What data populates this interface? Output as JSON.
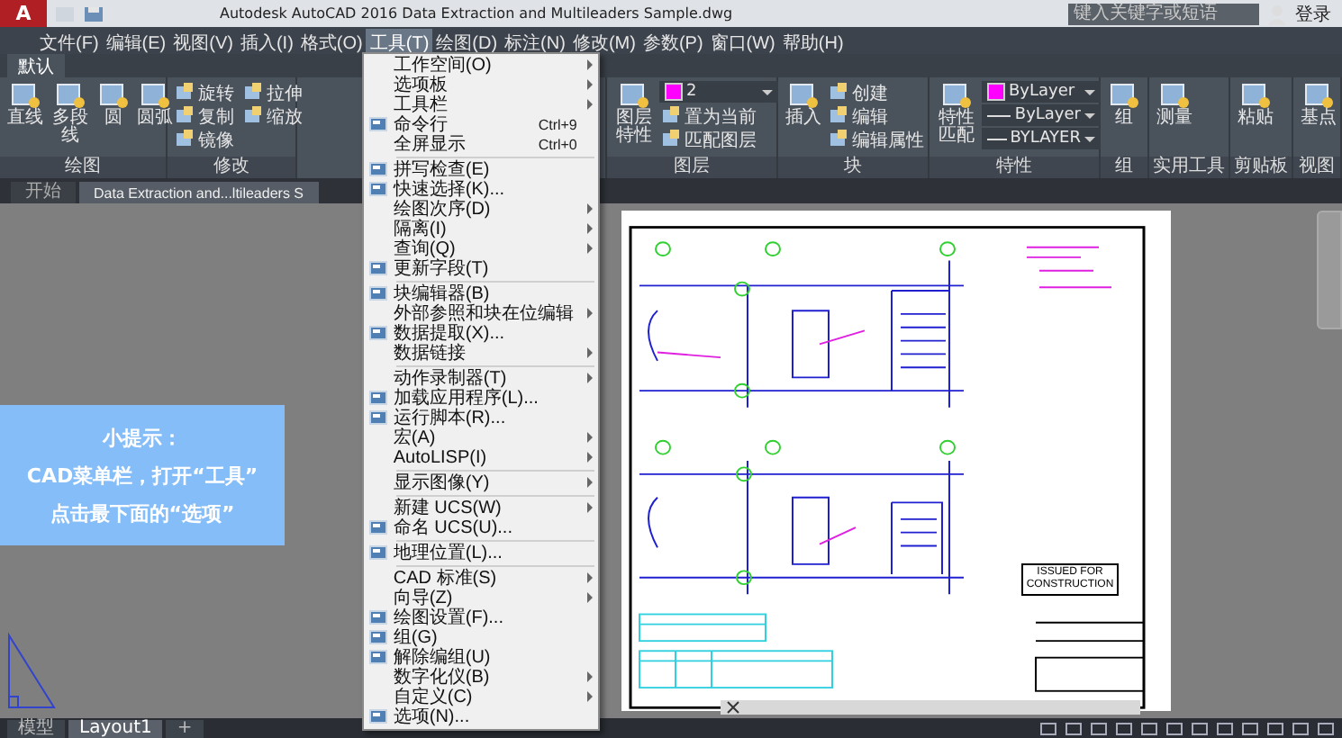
{
  "title_bar": {
    "app_button": "A",
    "title": "Autodesk AutoCAD 2016    Data Extraction and Multileaders Sample.dwg",
    "search": {
      "placeholder": "键入关键字或短语"
    },
    "sign_in": "登录"
  },
  "menu_bar": [
    {
      "label": "文件(F)",
      "selected": false
    },
    {
      "label": "编辑(E)",
      "selected": false
    },
    {
      "label": "视图(V)",
      "selected": false
    },
    {
      "label": "插入(I)",
      "selected": false
    },
    {
      "label": "格式(O)",
      "selected": false
    },
    {
      "label": "工具(T)",
      "selected": true
    },
    {
      "label": "绘图(D)",
      "selected": false
    },
    {
      "label": "标注(N)",
      "selected": false
    },
    {
      "label": "修改(M)",
      "selected": false
    },
    {
      "label": "参数(P)",
      "selected": false
    },
    {
      "label": "窗口(W)",
      "selected": false
    },
    {
      "label": "帮助(H)",
      "selected": false
    }
  ],
  "ribbon": {
    "tabs": [
      {
        "label": "默认",
        "selected": true
      }
    ],
    "panels": [
      {
        "title": "绘图",
        "tools": [
          {
            "kind": "large",
            "label": "直线"
          },
          {
            "kind": "large",
            "label": "多段线"
          },
          {
            "kind": "large",
            "label": "圆"
          },
          {
            "kind": "large",
            "label": "圆弧"
          }
        ]
      },
      {
        "title": "修改",
        "tools": [
          {
            "kind": "small",
            "label": "旋转"
          },
          {
            "kind": "small",
            "label": "复制"
          },
          {
            "kind": "small",
            "label": "镜像"
          },
          {
            "kind": "small",
            "label": "拉伸"
          },
          {
            "kind": "small",
            "label": "缩放"
          }
        ]
      },
      {
        "title": "图层",
        "tools": [
          {
            "kind": "large",
            "label": "图层特性"
          },
          {
            "kind": "dropdown",
            "label": "2",
            "color": "#ff00ff"
          },
          {
            "kind": "small",
            "label": "置为当前"
          },
          {
            "kind": "small",
            "label": "匹配图层"
          }
        ]
      },
      {
        "title": "块",
        "tools": [
          {
            "kind": "large",
            "label": "插入"
          },
          {
            "kind": "small",
            "label": "创建"
          },
          {
            "kind": "small",
            "label": "编辑"
          },
          {
            "kind": "small",
            "label": "编辑属性"
          }
        ]
      },
      {
        "title": "特性",
        "tools": [
          {
            "kind": "large",
            "label": "特性匹配"
          },
          {
            "kind": "dropdown",
            "label": "ByLayer",
            "color": "#ff00ff"
          },
          {
            "kind": "dropdown",
            "label": "ByLayer"
          },
          {
            "kind": "dropdown",
            "label": "BYLAYER"
          }
        ]
      },
      {
        "title": "组",
        "tools": [
          {
            "kind": "large",
            "label": "组"
          }
        ]
      },
      {
        "title": "实用工具",
        "tools": [
          {
            "kind": "large",
            "label": "测量"
          }
        ]
      },
      {
        "title": "剪贴板",
        "tools": [
          {
            "kind": "large",
            "label": "粘贴"
          }
        ]
      },
      {
        "title": "视图",
        "tools": [
          {
            "kind": "large",
            "label": "基点"
          }
        ]
      }
    ]
  },
  "doc_tabs": [
    {
      "label": "开始",
      "selected": false
    },
    {
      "label": "Data Extraction and...ltileaders S",
      "selected": true
    }
  ],
  "tip": {
    "title": "小提示：",
    "lines": [
      "CAD菜单栏，打开“工具”",
      "点击最下面的“选项”"
    ]
  },
  "drawing": {
    "stamp": "ISSUED FOR CONSTRUCTION"
  },
  "layout_tabs": [
    {
      "label": "模型",
      "selected": false
    },
    {
      "label": "Layout1",
      "selected": true
    },
    {
      "label": "+",
      "selected": false
    }
  ],
  "menu": {
    "groups": [
      {
        "items": [
          {
            "label": "工作空间(O)",
            "submenu": true,
            "has_icon": false
          },
          {
            "label": "选项板",
            "submenu": true,
            "has_icon": false
          },
          {
            "label": "工具栏",
            "submenu": true,
            "has_icon": false
          },
          {
            "label": "命令行",
            "shortcut": "Ctrl+9",
            "submenu": false,
            "has_icon": true
          },
          {
            "label": "全屏显示",
            "shortcut": "Ctrl+0",
            "submenu": false,
            "has_icon": false
          }
        ]
      },
      {
        "items": [
          {
            "label": "拼写检查(E)",
            "submenu": false,
            "has_icon": true
          },
          {
            "label": "快速选择(K)...",
            "submenu": false,
            "has_icon": true
          },
          {
            "label": "绘图次序(D)",
            "submenu": true,
            "has_icon": false
          },
          {
            "label": "隔离(I)",
            "submenu": true,
            "has_icon": false
          },
          {
            "label": "查询(Q)",
            "submenu": true,
            "has_icon": false
          },
          {
            "label": "更新字段(T)",
            "submenu": false,
            "has_icon": true
          }
        ]
      },
      {
        "items": [
          {
            "label": "块编辑器(B)",
            "submenu": false,
            "has_icon": true
          },
          {
            "label": "外部参照和块在位编辑",
            "submenu": true,
            "has_icon": false
          },
          {
            "label": "数据提取(X)...",
            "submenu": false,
            "has_icon": true
          },
          {
            "label": "数据链接",
            "submenu": true,
            "has_icon": false
          }
        ]
      },
      {
        "items": [
          {
            "label": "动作录制器(T)",
            "submenu": true,
            "has_icon": false
          },
          {
            "label": "加载应用程序(L)...",
            "submenu": false,
            "has_icon": true
          },
          {
            "label": "运行脚本(R)...",
            "submenu": false,
            "has_icon": true
          },
          {
            "label": "宏(A)",
            "submenu": true,
            "has_icon": false
          },
          {
            "label": "AutoLISP(I)",
            "submenu": true,
            "has_icon": false
          }
        ]
      },
      {
        "items": [
          {
            "label": "显示图像(Y)",
            "submenu": true,
            "has_icon": false
          }
        ]
      },
      {
        "items": [
          {
            "label": "新建 UCS(W)",
            "submenu": true,
            "has_icon": false
          },
          {
            "label": "命名 UCS(U)...",
            "submenu": false,
            "has_icon": true
          }
        ]
      },
      {
        "items": [
          {
            "label": "地理位置(L)...",
            "submenu": false,
            "has_icon": true
          }
        ]
      },
      {
        "items": [
          {
            "label": "CAD 标准(S)",
            "submenu": true,
            "has_icon": false
          },
          {
            "label": "向导(Z)",
            "submenu": true,
            "has_icon": false
          },
          {
            "label": "绘图设置(F)...",
            "submenu": false,
            "has_icon": true
          },
          {
            "label": "组(G)",
            "submenu": false,
            "has_icon": true
          },
          {
            "label": "解除编组(U)",
            "submenu": false,
            "has_icon": true
          },
          {
            "label": "数字化仪(B)",
            "submenu": true,
            "has_icon": false
          },
          {
            "label": "自定义(C)",
            "submenu": true,
            "has_icon": false
          },
          {
            "label": "选项(N)...",
            "submenu": false,
            "has_icon": true
          }
        ]
      }
    ]
  }
}
